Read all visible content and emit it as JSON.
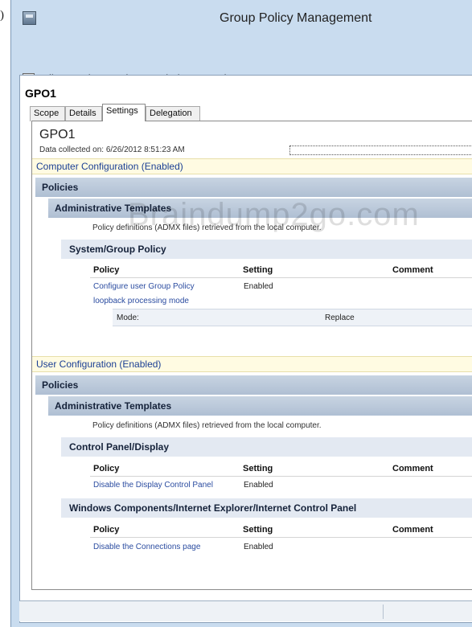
{
  "edge_glyph": ")",
  "window": {
    "title": "Group Policy Management"
  },
  "menubar": {
    "items": [
      {
        "key": "F",
        "rest": "ile"
      },
      {
        "key": "A",
        "rest": "ction"
      },
      {
        "key": "V",
        "rest": "iew"
      },
      {
        "key": "W",
        "rest": "indow"
      },
      {
        "key": "H",
        "rest": "elp"
      }
    ]
  },
  "toolbar": {
    "buttons": [
      "back-arrow-icon",
      "forward-arrow-icon",
      "up-folder-icon",
      "show-hide-tree-icon",
      "refresh-icon",
      "help-icon",
      "show-hide-action-pane-icon"
    ]
  },
  "pane": {
    "header": "GPO1",
    "tabs": [
      "Scope",
      "Details",
      "Settings",
      "Delegation"
    ],
    "active_tab": "Settings"
  },
  "report": {
    "title": "GPO1",
    "data_collected": "Data collected on: 6/26/2012 8:51:23 AM",
    "computer_config": {
      "title": "Computer Configuration (Enabled)",
      "policies_label": "Policies",
      "admin_templates_label": "Administrative Templates",
      "admx_note": "Policy definitions (ADMX files) retrieved from the local computer.",
      "category": "System/Group Policy",
      "headers": {
        "policy": "Policy",
        "setting": "Setting",
        "comment": "Comment"
      },
      "policy_line1": "Configure user Group Policy",
      "policy_line2": "loopback processing mode",
      "setting": "Enabled",
      "mode_label": "Mode:",
      "mode_value": "Replace"
    },
    "user_config": {
      "title": "User Configuration (Enabled)",
      "policies_label": "Policies",
      "admin_templates_label": "Administrative Templates",
      "admx_note": "Policy definitions (ADMX files) retrieved from the local computer.",
      "categories": [
        {
          "name": "Control Panel/Display",
          "headers": {
            "policy": "Policy",
            "setting": "Setting",
            "comment": "Comment"
          },
          "policy": "Disable the Display Control Panel",
          "setting": "Enabled"
        },
        {
          "name": "Windows Components/Internet Explorer/Internet Control Panel",
          "headers": {
            "policy": "Policy",
            "setting": "Setting",
            "comment": "Comment"
          },
          "policy": "Disable the Connections page",
          "setting": "Enabled"
        }
      ]
    }
  },
  "watermark": "Braindump2go.com",
  "colors": {
    "chrome": "#c9dcef",
    "link": "#2b4ca0",
    "config_bar": "#fffbe2",
    "section_bar": "#b9c8da"
  }
}
